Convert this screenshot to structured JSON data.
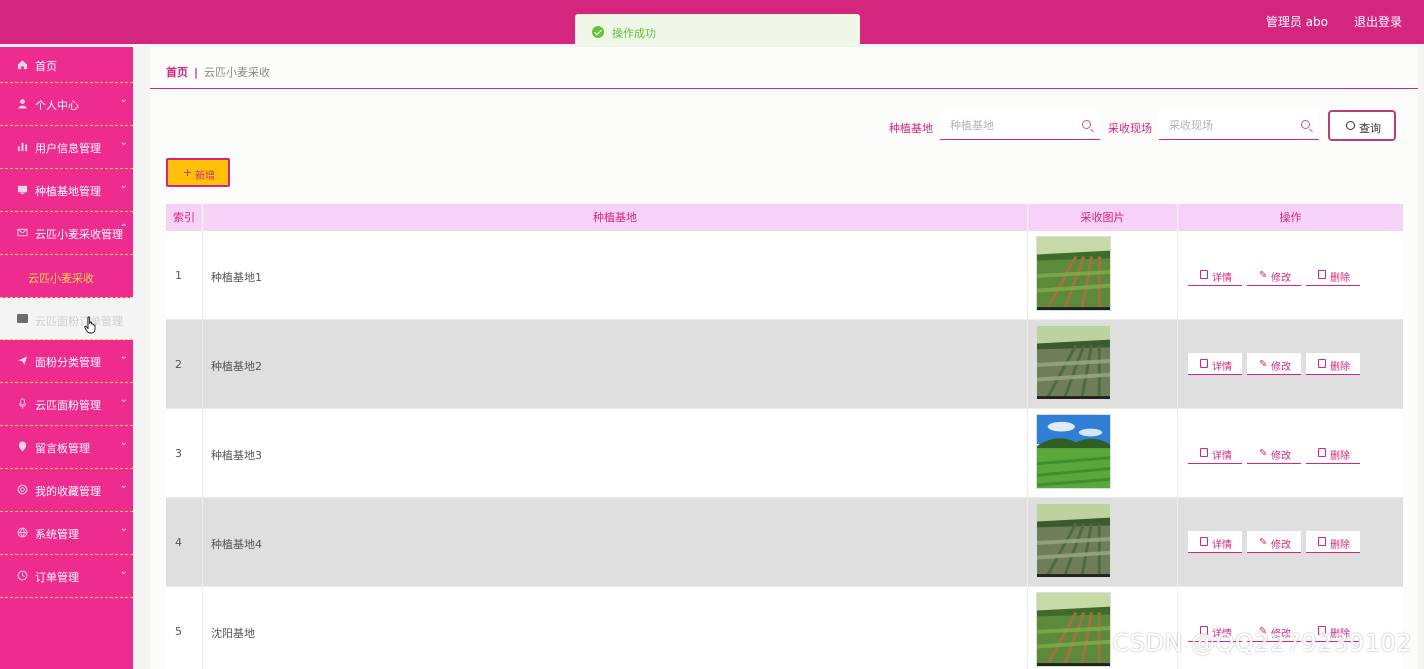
{
  "header": {
    "user_label": "管理员 abo",
    "logout_label": "退出登录",
    "bg_color": "#d4267f"
  },
  "toast": {
    "message": "操作成功",
    "icon": "check-circle-icon",
    "color": "#67c23a"
  },
  "sidebar": {
    "bg_color": "#ee2b8e",
    "items": [
      {
        "label": "首页",
        "icon": "home-icon",
        "has_chevron": false
      },
      {
        "label": "个人中心",
        "icon": "user-icon",
        "has_chevron": true
      },
      {
        "label": "用户信息管理",
        "icon": "bar-chart-icon",
        "has_chevron": true
      },
      {
        "label": "种植基地管理",
        "icon": "monitor-icon",
        "has_chevron": true
      },
      {
        "label": "云匹小麦采收管理",
        "icon": "mail-icon",
        "has_chevron": true,
        "expanded": true
      },
      {
        "label": "面粉分类管理",
        "icon": "send-icon",
        "has_chevron": true
      },
      {
        "label": "云匹面粉管理",
        "icon": "mic-icon",
        "has_chevron": true
      },
      {
        "label": "留言板管理",
        "icon": "location-icon",
        "has_chevron": true
      },
      {
        "label": "我的收藏管理",
        "icon": "support-icon",
        "has_chevron": true
      },
      {
        "label": "系统管理",
        "icon": "globe-icon",
        "has_chevron": true
      },
      {
        "label": "订单管理",
        "icon": "clock-icon",
        "has_chevron": true
      }
    ],
    "submenu_label": "云匹小麦采收",
    "hover_label": "云匹面粉订单管理"
  },
  "breadcrumb": {
    "home": "首页",
    "separator": "|",
    "current": "云匹小麦采收"
  },
  "search": {
    "field1_label": "种植基地",
    "field1_placeholder": "种植基地",
    "field2_label": "采收现场",
    "field2_placeholder": "采收现场",
    "query_label": "查询"
  },
  "add_button_label": "新增",
  "table": {
    "headers": [
      "索引",
      "种植基地",
      "采收图片",
      "操作"
    ],
    "rows": [
      {
        "index": "1",
        "base": "种植基地1",
        "image": "field-photo-1"
      },
      {
        "index": "2",
        "base": "种植基地2",
        "image": "field-photo-2"
      },
      {
        "index": "3",
        "base": "种植基地3",
        "image": "field-photo-3"
      },
      {
        "index": "4",
        "base": "种植基地4",
        "image": "field-photo-4"
      },
      {
        "index": "5",
        "base": "沈阳基地",
        "image": "field-photo-5"
      }
    ],
    "actions": {
      "detail": "详情",
      "edit": "修改",
      "delete": "删除"
    }
  },
  "watermark": "CSDN @QQ2279239102"
}
